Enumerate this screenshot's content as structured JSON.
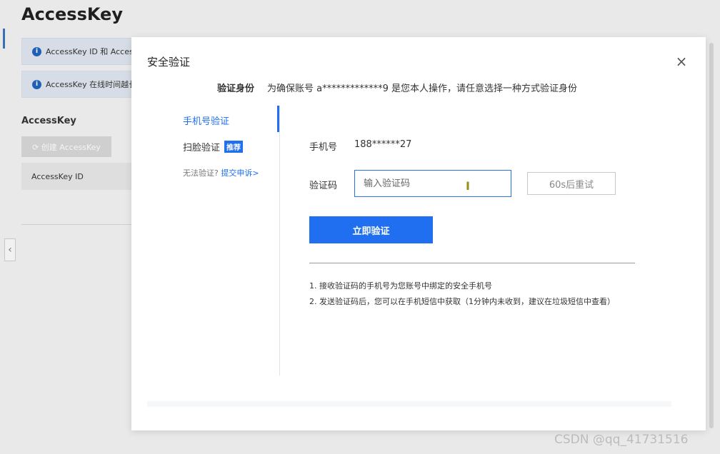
{
  "background": {
    "page_title": "AccessKey",
    "notices": [
      {
        "text": "AccessKey ID 和 AccessK"
      },
      {
        "text": "AccessKey 在线时间越长"
      }
    ],
    "section_title": "AccessKey",
    "create_button": "⟳ 创建 AccessKey",
    "table_header": "AccessKey ID"
  },
  "modal": {
    "title": "安全验证",
    "close_icon": "×",
    "identity_label": "验证身份",
    "identity_desc": "为确保账号 a*************9 是您本人操作，请任意选择一种方式验证身份",
    "nav": {
      "phone": "手机号验证",
      "face": "扫脸验证",
      "face_badge": "推荐",
      "help_text": "无法验证?",
      "help_link": "提交申诉>"
    },
    "form": {
      "phone_label": "手机号",
      "phone_value": "188******27",
      "code_label": "验证码",
      "code_placeholder": "输入验证码",
      "code_value": "",
      "retry_button": "60s后重试",
      "verify_button": "立即验证"
    },
    "notes": [
      "1. 接收验证码的手机号为您账号中绑定的安全手机号",
      "2. 发送验证码后，您可以在手机短信中获取（1分钟内未收到，建议在垃圾短信中查看）"
    ]
  },
  "watermark": "CSDN @qq_41731516",
  "colors": {
    "accent": "#1f6ff0",
    "overlay": "#e9e9e9"
  }
}
